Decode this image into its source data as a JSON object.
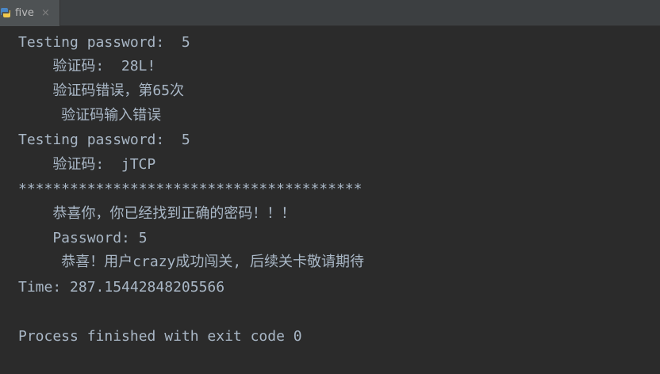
{
  "tab": {
    "label": "five",
    "close_glyph": "×",
    "icon": "python-icon"
  },
  "console": {
    "lines": [
      "Testing password:  5",
      "    验证码:  28L!",
      "    验证码错误，第65次",
      "     验证码输入错误",
      "Testing password:  5",
      "    验证码:  jTCP",
      "****************************************",
      "    恭喜你，你已经找到正确的密码！！！",
      "    Password: 5",
      "     恭喜！用户crazy成功闯关, 后续关卡敬请期待",
      "Time: 287.15442848205566",
      "",
      "Process finished with exit code 0"
    ]
  },
  "colors": {
    "background": "#2b2b2b",
    "text": "#a9b7c6",
    "tabbar": "#3c3f41"
  }
}
